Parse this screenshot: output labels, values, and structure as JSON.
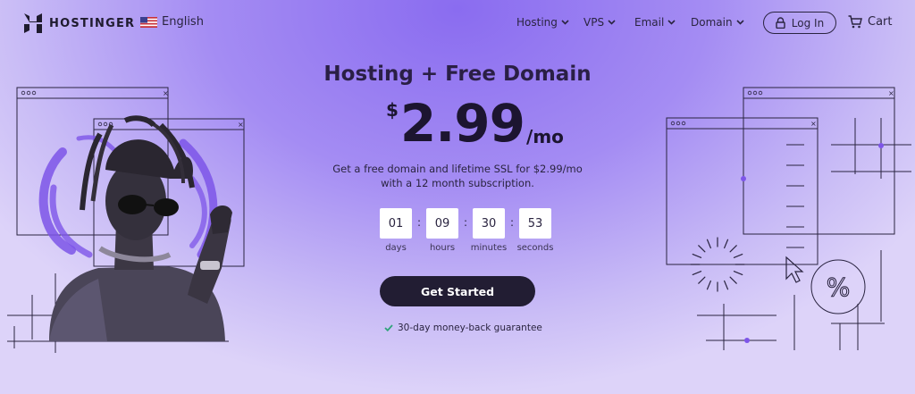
{
  "nav": {
    "brand": "HOSTINGER",
    "language": "English",
    "menu": [
      {
        "label": "Hosting"
      },
      {
        "label": "VPS"
      },
      {
        "label": "Email"
      },
      {
        "label": "Domain"
      }
    ],
    "login": "Log In",
    "cart": "Cart"
  },
  "hero": {
    "title": "Hosting + Free Domain",
    "currency": "$",
    "price": "2.99",
    "period": "/mo",
    "desc_line1": "Get a free domain and lifetime SSL for $2.99/mo",
    "desc_line2": "with a 12 month subscription.",
    "cta": "Get Started",
    "guarantee": "30-day money-back guarantee"
  },
  "countdown": [
    {
      "value": "01",
      "label": "days"
    },
    {
      "value": "09",
      "label": "hours"
    },
    {
      "value": "30",
      "label": "minutes"
    },
    {
      "value": "53",
      "label": "seconds"
    }
  ],
  "colors": {
    "accent": "#8a6cf0",
    "cta_bg": "#221d33",
    "check": "#2fa37a"
  },
  "icons": {
    "logo": "hostinger-logo-icon",
    "flag": "us-flag-icon",
    "chevron": "chevron-down-icon",
    "lock": "lock-icon",
    "cart": "cart-icon",
    "check": "check-icon",
    "cursor": "cursor-icon",
    "percent": "percent-icon"
  }
}
